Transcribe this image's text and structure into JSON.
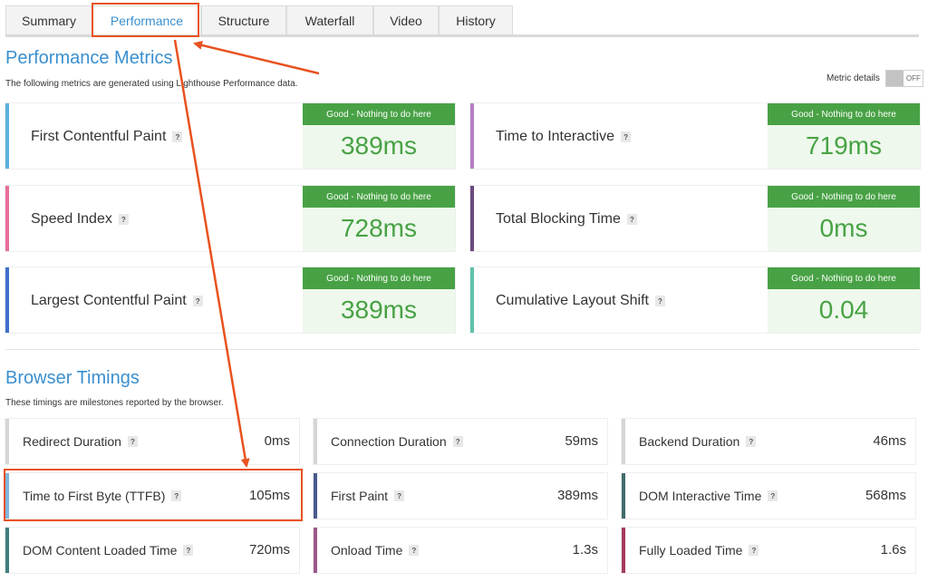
{
  "tabs": [
    {
      "label": "Summary",
      "active": false
    },
    {
      "label": "Performance",
      "active": true
    },
    {
      "label": "Structure",
      "active": false
    },
    {
      "label": "Waterfall",
      "active": false
    },
    {
      "label": "Video",
      "active": false
    },
    {
      "label": "History",
      "active": false
    }
  ],
  "performance": {
    "title": "Performance Metrics",
    "description": "The following metrics are generated using Lighthouse Performance data.",
    "metric_details_label": "Metric details",
    "toggle_state": "OFF",
    "grade_label": "Good - Nothing to do here",
    "metrics": [
      {
        "name": "First Contentful Paint",
        "value": "389ms",
        "accent": "#5ab0de"
      },
      {
        "name": "Time to Interactive",
        "value": "719ms",
        "accent": "#b57fc4"
      },
      {
        "name": "Speed Index",
        "value": "728ms",
        "accent": "#e86e9b"
      },
      {
        "name": "Total Blocking Time",
        "value": "0ms",
        "accent": "#6b4a7e"
      },
      {
        "name": "Largest Contentful Paint",
        "value": "389ms",
        "accent": "#3d6fcd"
      },
      {
        "name": "Cumulative Layout Shift",
        "value": "0.04",
        "accent": "#5fc3ab"
      }
    ]
  },
  "browser": {
    "title": "Browser Timings",
    "description": "These timings are milestones reported by the browser.",
    "timings": [
      {
        "name": "Redirect Duration",
        "value": "0ms",
        "accent": "#d6d6d6"
      },
      {
        "name": "Connection Duration",
        "value": "59ms",
        "accent": "#d6d6d6"
      },
      {
        "name": "Backend Duration",
        "value": "46ms",
        "accent": "#d6d6d6"
      },
      {
        "name": "Time to First Byte (TTFB)",
        "value": "105ms",
        "accent": "#7fb6dd"
      },
      {
        "name": "First Paint",
        "value": "389ms",
        "accent": "#4a5a8e"
      },
      {
        "name": "DOM Interactive Time",
        "value": "568ms",
        "accent": "#3f6b6a"
      },
      {
        "name": "DOM Content Loaded Time",
        "value": "720ms",
        "accent": "#3f7f7d"
      },
      {
        "name": "Onload Time",
        "value": "1.3s",
        "accent": "#9c5a8a"
      },
      {
        "name": "Fully Loaded Time",
        "value": "1.6s",
        "accent": "#a33a5e"
      }
    ]
  },
  "help_glyph": "?",
  "colors": {
    "accent_blue": "#3a8fcf",
    "good_green": "#48a245",
    "annotation_orange": "#e8521f"
  }
}
